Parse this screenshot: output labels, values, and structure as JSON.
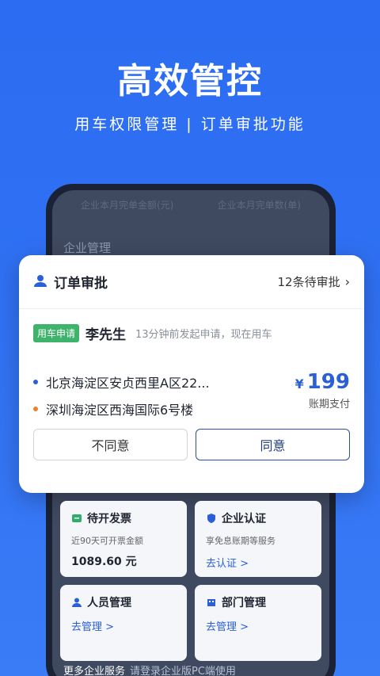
{
  "hero": {
    "title": "高效管控",
    "subtitle": "用车权限管理 | 订单审批功能"
  },
  "phone": {
    "stats": {
      "left": "企业本月完单金额(元)",
      "right": "企业本月完单数(单)"
    },
    "section_title": "企业管理"
  },
  "approval": {
    "title": "订单审批",
    "pending": "12条待审批",
    "badge": "用车申请",
    "name": "李先生",
    "time": "13分钟前发起申请，现在用车",
    "from": "北京海淀区安贞西里A区22...",
    "to": "深圳海淀区西海国际6号楼",
    "currency": "¥",
    "price": "199",
    "pay_type": "账期支付",
    "reject": "不同意",
    "agree": "同意",
    "colors": {
      "from_dot": "#2a5fd8",
      "to_dot": "#f07f2a",
      "accent": "#2a5fd8"
    }
  },
  "tiles": [
    {
      "title": "待开发票",
      "sub": "近90天可开票金额",
      "value": "1089.60 元",
      "icon": "invoice-icon"
    },
    {
      "title": "企业认证",
      "sub": "享免息账期等服务",
      "link": "去认证 >",
      "icon": "shield-icon"
    },
    {
      "title": "人员管理",
      "link": "去管理 >",
      "icon": "person-icon"
    },
    {
      "title": "部门管理",
      "link": "去管理 >",
      "icon": "department-icon"
    }
  ],
  "more": {
    "title": "更多企业服务",
    "hint": "请登录企业版PC端使用"
  }
}
